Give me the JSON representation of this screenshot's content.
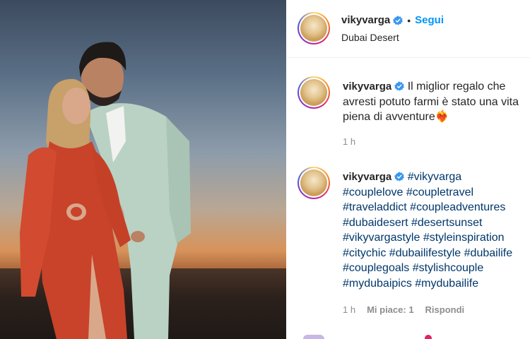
{
  "post": {
    "username": "vikyvarga",
    "follow_label": "Segui",
    "location": "Dubai Desert"
  },
  "caption": {
    "username": "vikyvarga",
    "lines": [
      "Il miglior regalo che",
      "avresti potuto farmi è stato una vita",
      "piena di avventure"
    ],
    "emoji": "❤️‍🔥",
    "time": "1 h"
  },
  "hashtag_comment": {
    "username": "vikyvarga",
    "tags": [
      "#vikyvarga",
      "#couplelove #coupletravel",
      "#traveladdict #coupleadventures",
      "#dubaidesert #desertsunset",
      "#vikyvargastyle #styleinspiration",
      "#citychic #dubailifestyle #dubailife",
      "#couplegoals #stylishcouple",
      "#mydubaipics #mydubailife"
    ],
    "time": "1 h",
    "likes": "Mi piace: 1",
    "reply": "Rispondi"
  },
  "colors": {
    "link_blue": "#0095f6",
    "hashtag": "#00376b",
    "meta_gray": "#8e8e8e",
    "verified_blue": "#3897f0"
  }
}
